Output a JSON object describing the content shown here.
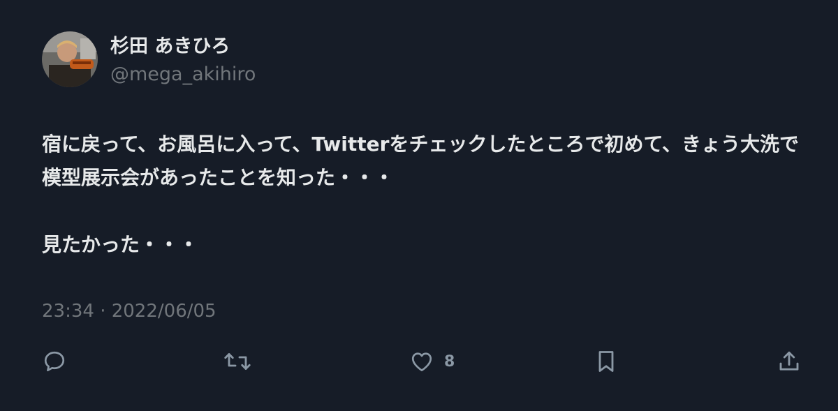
{
  "tweet": {
    "author": {
      "display_name": "杉田 あきひろ",
      "handle": "@mega_akihiro"
    },
    "text_paragraphs": [
      "宿に戻って、お風呂に入って、Twitterをチェックしたところで初めて、きょう大洗で模型展示会があったことを知った・・・",
      "見たかった・・・"
    ],
    "timestamp": "23:34 · 2022/06/05",
    "actions": {
      "reply_icon": "reply-icon",
      "retweet_icon": "retweet-icon",
      "like_icon": "heart-icon",
      "like_count": "8",
      "bookmark_icon": "bookmark-icon",
      "share_icon": "share-icon"
    }
  },
  "colors": {
    "background": "#161c27",
    "primary_text": "#e7e9ea",
    "secondary_text": "#71767b",
    "icon": "#8b98a5"
  }
}
